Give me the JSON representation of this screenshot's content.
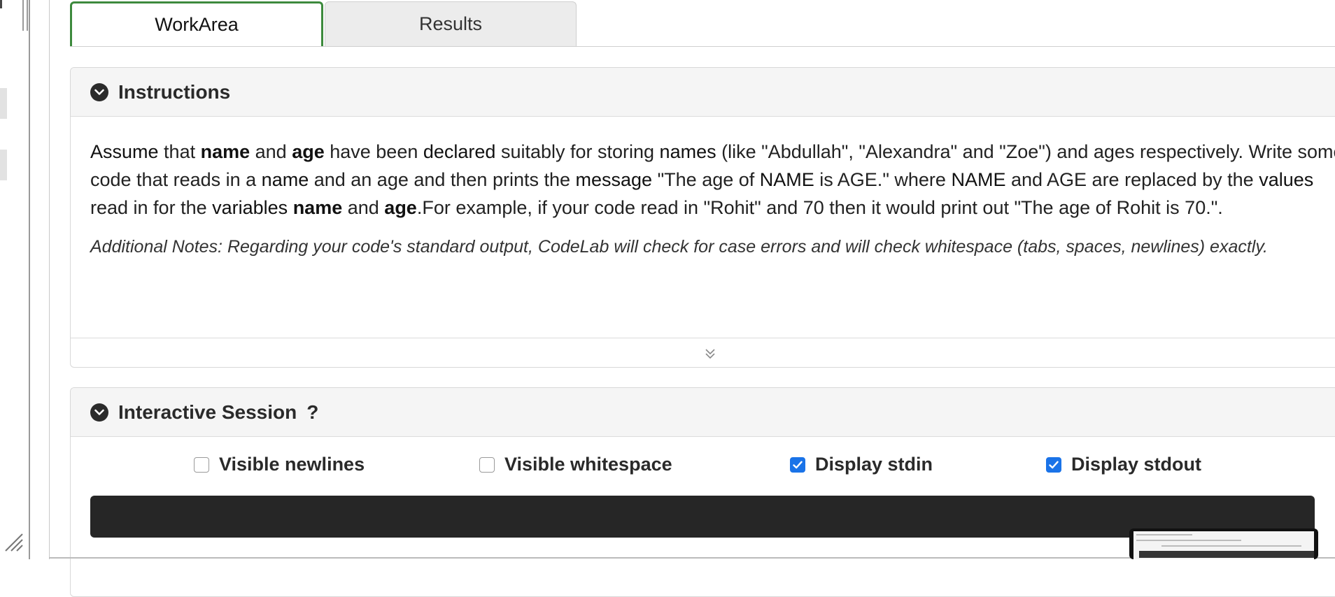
{
  "tabs": [
    {
      "label": "WorkArea",
      "active": true
    },
    {
      "label": "Results",
      "active": false
    }
  ],
  "instructions": {
    "title": "Instructions",
    "paragraph": [
      {
        "t": "Assume",
        "w": "n"
      },
      {
        "t": " that ",
        "w": "p"
      },
      {
        "t": "name",
        "w": "b"
      },
      {
        "t": " and ",
        "w": "p"
      },
      {
        "t": "age",
        "w": "b"
      },
      {
        "t": " have been ",
        "w": "p"
      },
      {
        "t": "declared",
        "w": "n"
      },
      {
        "t": " suitably for storing ",
        "w": "p"
      },
      {
        "t": "names",
        "w": "n"
      },
      {
        "t": " (like \"Abdullah\", \"Alexandra\" and \"Zoe\") and ages respectively. Write some code that reads in a ",
        "w": "p"
      },
      {
        "t": "name",
        "w": "n"
      },
      {
        "t": " and an age and then prints the ",
        "w": "p"
      },
      {
        "t": "message",
        "w": "n"
      },
      {
        "t": " \"The age of ",
        "w": "p"
      },
      {
        "t": "NAME",
        "w": "n"
      },
      {
        "t": " is AGE.\" where ",
        "w": "p"
      },
      {
        "t": "NAME",
        "w": "n"
      },
      {
        "t": " and AGE are replaced by the ",
        "w": "p"
      },
      {
        "t": "values",
        "w": "n"
      },
      {
        "t": " read in for the ",
        "w": "p"
      },
      {
        "t": "variables",
        "w": "n"
      },
      {
        "t": " ",
        "w": "p"
      },
      {
        "t": "name",
        "w": "b"
      },
      {
        "t": " and ",
        "w": "p"
      },
      {
        "t": "age",
        "w": "b"
      },
      {
        "t": ".For example, if your code read in \"Rohit\" and 70 then it would print out \"The age of Rohit is 70.\".",
        "w": "p"
      }
    ],
    "notes": "Additional Notes: Regarding your code's standard output, CodeLab will check for case errors and will check whitespace (tabs, spaces, newlines) exactly."
  },
  "interactive": {
    "title": "Interactive Session",
    "help": "?",
    "options": [
      {
        "label": "Visible newlines",
        "checked": false
      },
      {
        "label": "Visible whitespace",
        "checked": false
      },
      {
        "label": "Display stdin",
        "checked": true
      },
      {
        "label": "Display stdout",
        "checked": true
      }
    ]
  },
  "colors": {
    "active_tab_border": "#3d8a3d",
    "checkbox_checked": "#1a73e8",
    "console_bg": "#262626"
  },
  "icons": {
    "section_toggle": "chevron-circle-down-icon",
    "expand": "double-chevron-down-icon",
    "resize": "resize-grip-icon"
  }
}
